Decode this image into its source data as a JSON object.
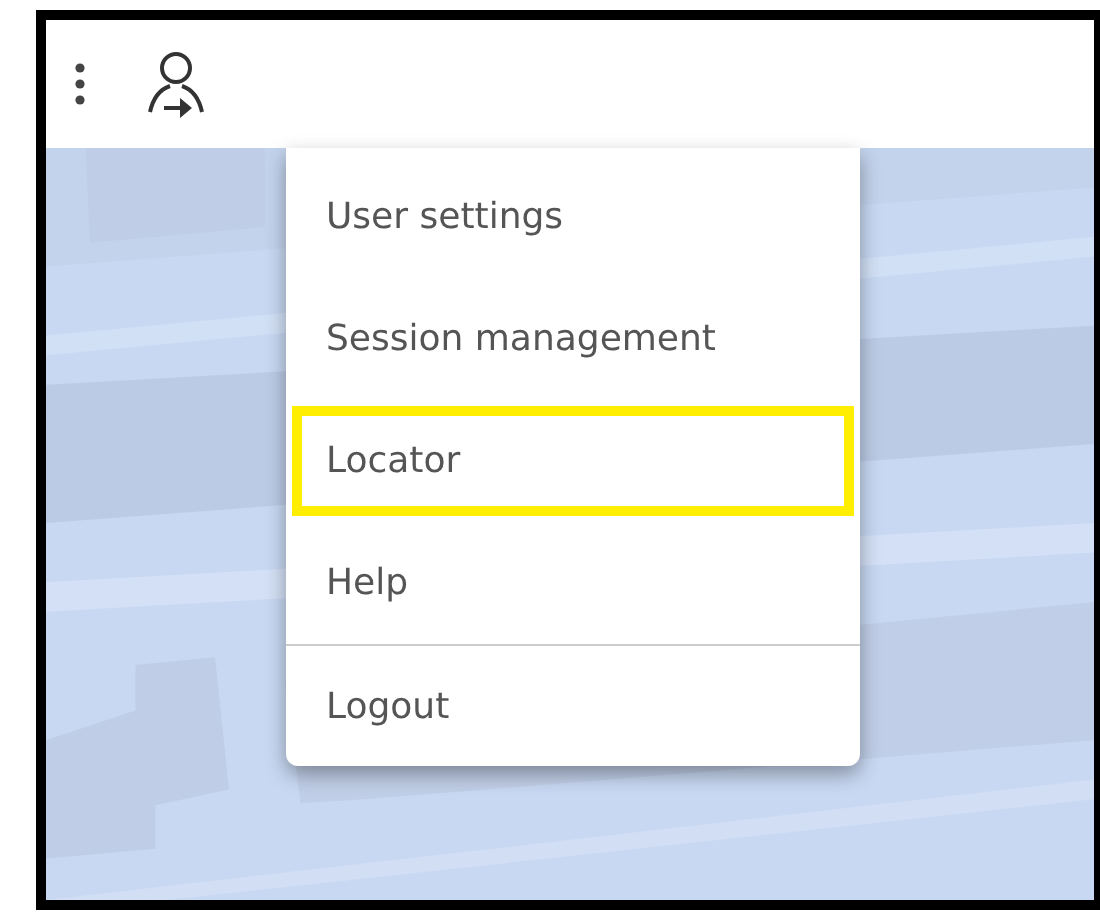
{
  "toolbar": {
    "buttons": [
      {
        "kind": "more"
      },
      {
        "kind": "user"
      }
    ]
  },
  "menu": {
    "items": [
      {
        "label": "User settings",
        "highlighted": false,
        "separated": false
      },
      {
        "label": "Session management",
        "highlighted": false,
        "separated": false
      },
      {
        "label": "Locator",
        "highlighted": true,
        "separated": false
      },
      {
        "label": "Help",
        "highlighted": false,
        "separated": false
      },
      {
        "label": "Logout",
        "highlighted": false,
        "separated": true
      }
    ]
  }
}
